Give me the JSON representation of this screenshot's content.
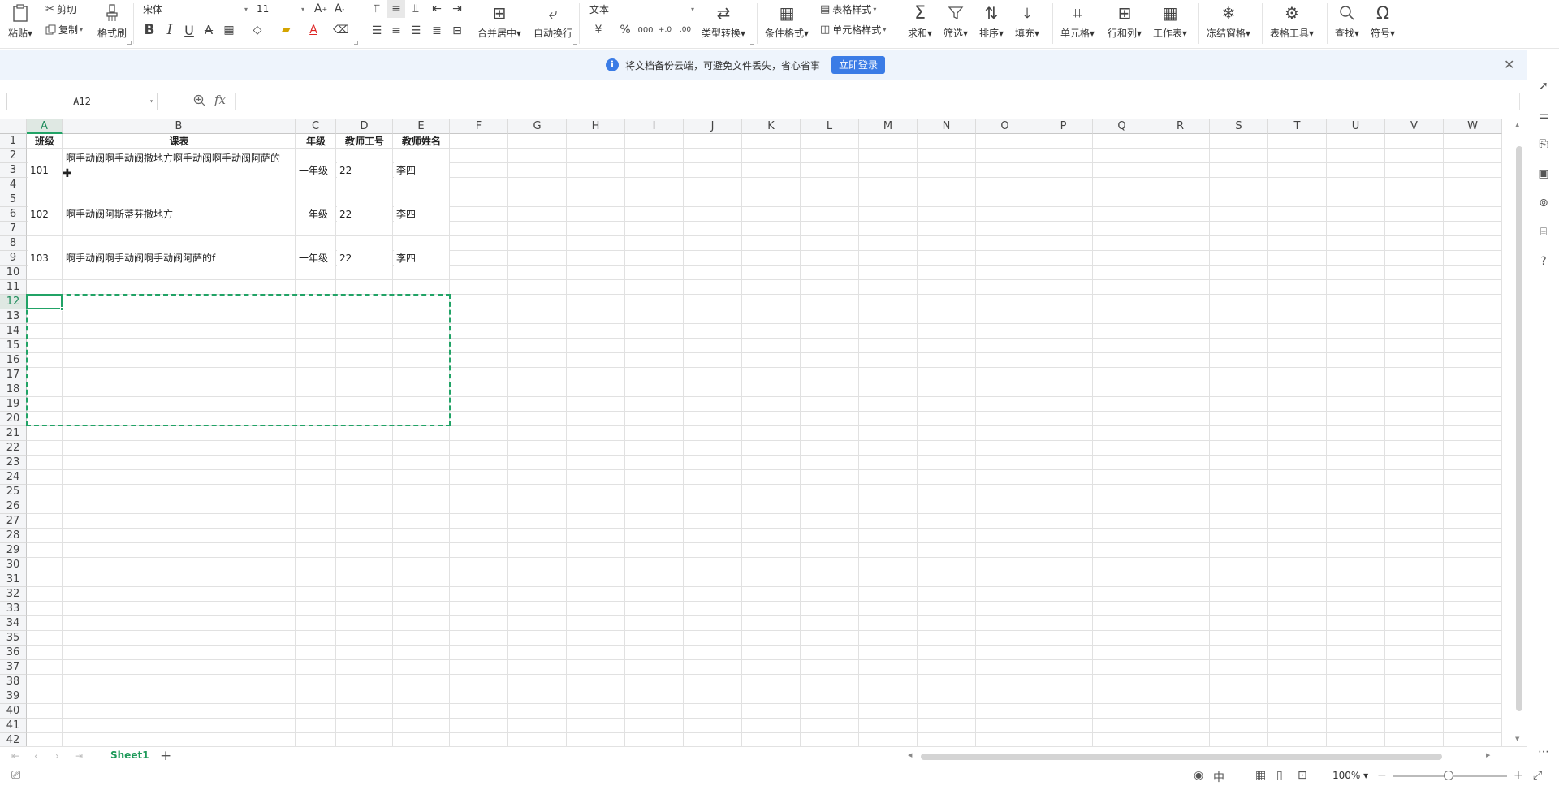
{
  "ribbon": {
    "paste": "粘贴",
    "cut": "剪切",
    "copy": "复制",
    "format_painter": "格式刷",
    "font_name": "宋体",
    "font_size": "11",
    "merge_center": "合并居中",
    "wrap_text": "自动换行",
    "number_format": "文本",
    "type_convert": "类型转换",
    "conditional_format": "条件格式",
    "table_style": "表格样式",
    "cell_style": "单元格样式",
    "sum": "求和",
    "filter": "筛选",
    "sort": "排序",
    "fill": "填充",
    "cell": "单元格",
    "row_col": "行和列",
    "worksheet": "工作表",
    "freeze": "冻结窗格",
    "table_tools": "表格工具",
    "find": "查找",
    "symbol": "符号"
  },
  "notice": {
    "message": "将文档备份云端，可避免文件丢失，省心省事",
    "login_button": "立即登录"
  },
  "formula_bar": {
    "name_box": "A12",
    "formula": ""
  },
  "sheet": {
    "columns": [
      "A",
      "B",
      "C",
      "D",
      "E",
      "F",
      "G",
      "H",
      "I",
      "J",
      "K",
      "L",
      "M",
      "N",
      "O",
      "P",
      "Q",
      "R",
      "S",
      "T",
      "U",
      "V",
      "W"
    ],
    "headers": {
      "A": "班级",
      "B": "课表",
      "C": "年级",
      "D": "教师工号",
      "E": "教师姓名"
    },
    "records": [
      {
        "rows": "2-4",
        "class": "101",
        "schedule": "啊手动阀啊手动阀撒地方啊手动阀啊手动阀阿萨的",
        "grade": "一年级",
        "teacher_id": "22",
        "teacher_name": "李四"
      },
      {
        "rows": "5-7",
        "class": "102",
        "schedule": "啊手动阀阿斯蒂芬撒地方",
        "grade": "一年级",
        "teacher_id": "22",
        "teacher_name": "李四"
      },
      {
        "rows": "8-10",
        "class": "103",
        "schedule": "啊手动阀啊手动阀啊手动阀阿萨的f",
        "grade": "一年级",
        "teacher_id": "22",
        "teacher_name": "李四"
      }
    ],
    "active_cell": "A12",
    "copy_range": "A12:E20",
    "row_count_visible": 42
  },
  "tabs": {
    "sheets": [
      "Sheet1"
    ],
    "active": "Sheet1"
  },
  "status": {
    "zoom": "100%"
  },
  "colors": {
    "accent": "#21a366",
    "login_blue": "#3b7ce6",
    "notice_bg": "#eef4fc"
  }
}
